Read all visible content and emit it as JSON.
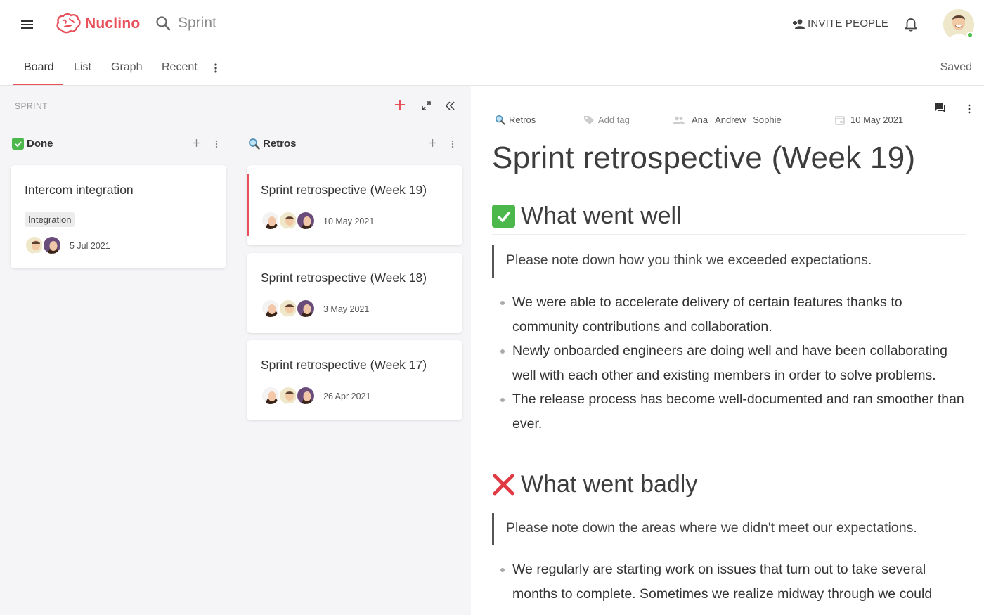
{
  "header": {
    "app_name": "Nuclino",
    "search_text": "Sprint",
    "invite_label": "INVITE PEOPLE"
  },
  "tabs": [
    {
      "label": "Board"
    },
    {
      "label": "List"
    },
    {
      "label": "Graph"
    },
    {
      "label": "Recent"
    }
  ],
  "status": "Saved",
  "board": {
    "label": "SPRINT",
    "columns": [
      {
        "name": "Done",
        "cards": [
          {
            "title": "Intercom integration",
            "tag": "Integration",
            "date": "5 Jul 2021"
          }
        ]
      },
      {
        "name": "Retros",
        "cards": [
          {
            "title": "Sprint retrospective (Week 19)",
            "date": "10 May 2021"
          },
          {
            "title": "Sprint retrospective (Week 18)",
            "date": "3 May 2021"
          },
          {
            "title": "Sprint retrospective (Week 17)",
            "date": "26 Apr 2021"
          }
        ]
      }
    ]
  },
  "document": {
    "collection": "Retros",
    "add_tag": "Add tag",
    "assignees": [
      "Ana",
      "Andrew",
      "Sophie"
    ],
    "date": "10 May 2021",
    "title": "Sprint retrospective (Week 19)",
    "sections": [
      {
        "heading": "What went well",
        "quote": "Please note down how you think we exceeded expectations.",
        "bullets": [
          "We were able to accelerate delivery of certain features thanks to community contributions and collaboration.",
          "Newly onboarded engineers are doing well and have been collaborating well with each other and existing members in order to solve problems.",
          "The release process has become well-documented and ran smoother than ever."
        ]
      },
      {
        "heading": "What went badly",
        "quote": "Please note down the areas where we didn't meet our expectations.",
        "bullets": [
          "We regularly are starting work on issues that turn out to take several months to complete. Sometimes we realize midway through we could"
        ]
      }
    ]
  },
  "colors": {
    "accent": "#e8505b",
    "board_bg": "#f5f5f7",
    "check_green": "#4cb84c",
    "cross_red": "#e03a45"
  },
  "icons": [
    "hamburger-icon",
    "brain-logo-icon",
    "search-icon",
    "add-person-icon",
    "bell-icon",
    "more-vertical-icon",
    "plus-icon",
    "expand-icon",
    "collapse-icon",
    "check-mark-icon",
    "magnifier-icon",
    "tag-icon",
    "people-icon",
    "calendar-icon",
    "comment-icon",
    "cross-icon"
  ]
}
